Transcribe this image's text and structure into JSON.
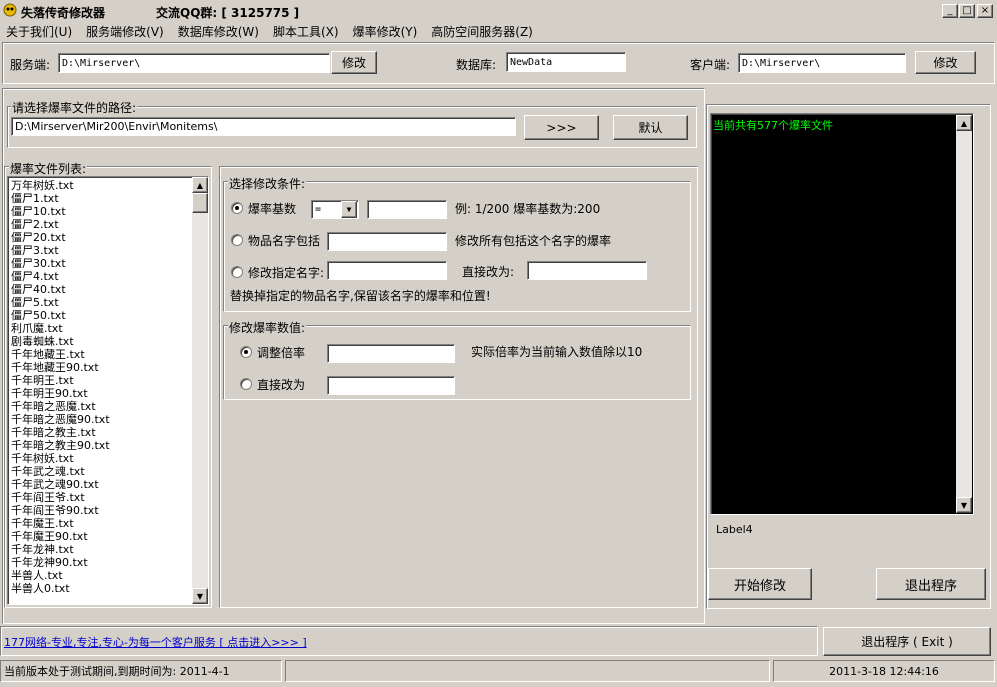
{
  "window": {
    "title": "失落传奇修改器",
    "qq_label": "交流QQ群: [ 3125775 ]",
    "caption_buttons": {
      "minimize": "_",
      "maximize": "□",
      "close": "×"
    }
  },
  "menu": [
    "关于我们(U)",
    "服务端修改(V)",
    "数据库修改(W)",
    "脚本工具(X)",
    "爆率修改(Y)",
    "高防空间服务器(Z)"
  ],
  "paths": {
    "server_label": "服务端:",
    "server_value": "D:\\Mirserver\\",
    "server_button": "修改",
    "db_label": "数据库:",
    "db_value": "NewData",
    "client_label": "客户端:",
    "client_value": "D:\\Mirserver\\",
    "client_button": "修改"
  },
  "rate_path": {
    "group_title": "请选择爆率文件的路径:",
    "value": "D:\\Mirserver\\Mir200\\Envir\\Monitems\\",
    "browse_button": ">>>",
    "default_button": "默认"
  },
  "file_list": {
    "group_title": "爆率文件列表:",
    "items": [
      "万年树妖.txt",
      "僵尸1.txt",
      "僵尸10.txt",
      "僵尸2.txt",
      "僵尸20.txt",
      "僵尸3.txt",
      "僵尸30.txt",
      "僵尸4.txt",
      "僵尸40.txt",
      "僵尸5.txt",
      "僵尸50.txt",
      "利爪魔.txt",
      "剧毒蜘蛛.txt",
      "千年地藏王.txt",
      "千年地藏王90.txt",
      "千年明王.txt",
      "千年明王90.txt",
      "千年暗之恶魔.txt",
      "千年暗之恶魔90.txt",
      "千年暗之教主.txt",
      "千年暗之教主90.txt",
      "千年树妖.txt",
      "千年武之魂.txt",
      "千年武之魂90.txt",
      "千年阎王爷.txt",
      "千年阎王爷90.txt",
      "千年魔王.txt",
      "千年魔王90.txt",
      "千年龙神.txt",
      "千年龙神90.txt",
      "半兽人.txt",
      "半兽人0.txt"
    ]
  },
  "conditions": {
    "group_title": "选择修改条件:",
    "opt1_label": "爆率基数",
    "opt1_combo": "=",
    "opt1_hint": "例: 1/200 爆率基数为:200",
    "opt2_label": "物品名字包括",
    "opt2_hint": "修改所有包括这个名字的爆率",
    "opt3_label": "修改指定名字:",
    "opt3_mid": "直接改为:",
    "note": "替换掉指定的物品名字,保留该名字的爆率和位置!"
  },
  "values": {
    "group_title": "修改爆率数值:",
    "opt1_label": "调整倍率",
    "opt1_hint": "实际倍率为当前输入数值除以10",
    "opt2_label": "直接改为"
  },
  "console": {
    "text": "当前共有577个爆率文件",
    "text_color": "#00ff00",
    "bg_color": "#000000",
    "label": "Label4"
  },
  "actions": {
    "start": "开始修改",
    "exit": "退出程序"
  },
  "footer": {
    "link": "177网络-专业,专注,专心-为每一个客户服务 [ 点击进入>>> ]",
    "link_color": "#0000cc",
    "exit_button": "退出程序 ( Exit )"
  },
  "status": {
    "left": "当前版本处于测试期间,到期时间为: 2011-4-1",
    "middle": "",
    "right": "2011-3-18 12:44:16"
  }
}
